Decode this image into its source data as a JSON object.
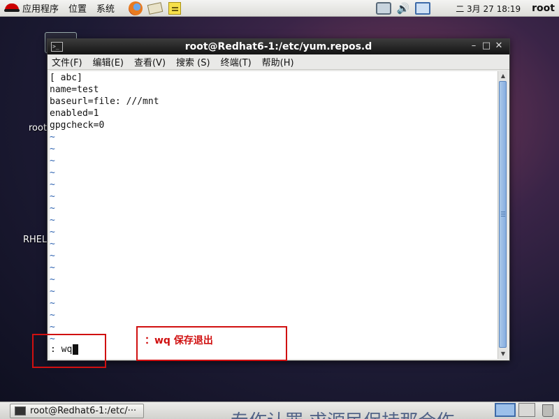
{
  "top_panel": {
    "menus": [
      "应用程序",
      "位置",
      "系统"
    ],
    "launchers": [
      "firefox-icon",
      "mail-icon",
      "notes-icon"
    ],
    "clock": "二 3月 27 18:19",
    "user": "root"
  },
  "desktop": {
    "icons": [
      {
        "label": "root",
        "icon": "home-folder-icon"
      },
      {
        "label": "RHEL_",
        "icon": "disc-icon"
      }
    ]
  },
  "terminal": {
    "title": "root@Redhat6-1:/etc/yum.repos.d",
    "window_buttons": [
      "–",
      "□",
      "✕"
    ],
    "menu": [
      "文件(F)",
      "编辑(E)",
      "查看(V)",
      "搜索 (S)",
      "终端(T)",
      "帮助(H)"
    ],
    "file_lines": [
      "[ abc]",
      "name=test",
      "baseurl=file: ///mnt",
      "enabled=1",
      "gpgcheck=0"
    ],
    "tilde_char": "~",
    "tilde_count": 18,
    "command": ": wq"
  },
  "annotation": {
    "text": "：wq   保存退出",
    "color": "#d01010"
  },
  "taskbar": {
    "tasks": [
      "root@Redhat6-1:/etc/···"
    ]
  },
  "watermark": "专作认罪 求源民保持那合作"
}
